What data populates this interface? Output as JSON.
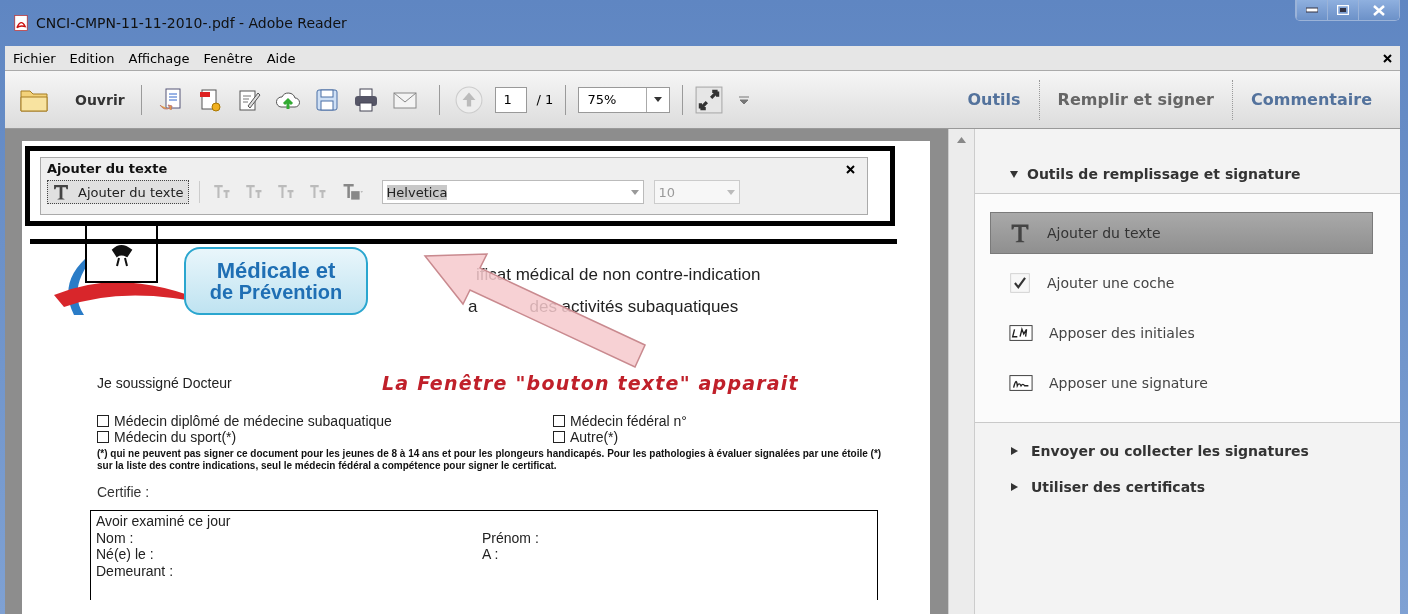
{
  "window": {
    "title": "CNCI-CMPN-11-11-2010-.pdf - Adobe Reader"
  },
  "menu": [
    "Fichier",
    "Edition",
    "Affichage",
    "Fenêtre",
    "Aide"
  ],
  "toolbar": {
    "open_label": "Ouvrir",
    "page": "1",
    "page_total": "/ 1",
    "zoom": "75%",
    "tabs": [
      {
        "label": "Outils",
        "selected": false
      },
      {
        "label": "Remplir et signer",
        "selected": true
      },
      {
        "label": "Commentaire",
        "selected": false
      }
    ]
  },
  "text_toolbar": {
    "title": "Ajouter du texte",
    "button": "Ajouter du texte",
    "font": "Helvetica",
    "size": "10"
  },
  "document": {
    "logo_lines": [
      "Médicale et",
      "de Prévention"
    ],
    "heading_lines": [
      "ificat médical de non contre-indication",
      "des activités subaquatiques"
    ],
    "heading_fragment": "a",
    "signed": "Je soussigné Docteur",
    "options": [
      {
        "label": "Médecin diplômé de médecine subaquatique",
        "checked": false
      },
      {
        "label": "Médecin fédéral n°",
        "checked": false
      },
      {
        "label": "Médecin du sport(*)",
        "checked": false
      },
      {
        "label": "Autre(*)",
        "checked": false
      }
    ],
    "footnote": "(*) qui ne peuvent pas signer ce document pour les jeunes de 8 à 14 ans et pour les plongeurs handicapés. Pour les pathologies à évaluer  signalées par une étoile (*) sur la liste des contre indications, seul le médecin fédéral a compétence pour signer le certificat.",
    "certifie": "Certifie :",
    "exam_intro": "Avoir examiné ce jour",
    "exam_rows": [
      [
        "Nom :",
        "Prénom :"
      ],
      [
        "Né(e) le :",
        "A :"
      ],
      [
        "Demeurant :"
      ]
    ]
  },
  "annotation": "La Fenêtre \"bouton texte\" apparait",
  "panel": {
    "header": {
      "title": "Outils de remplissage et signature",
      "expanded": true
    },
    "items": [
      {
        "label": "Ajouter du texte",
        "kind": "text",
        "selected": true
      },
      {
        "label": "Ajouter une coche",
        "kind": "check",
        "selected": false
      },
      {
        "label": "Apposer des initiales",
        "kind": "initials",
        "selected": false
      },
      {
        "label": "Apposer une signature",
        "kind": "signature",
        "selected": false
      }
    ],
    "sections": [
      {
        "title": "Envoyer ou collecter les signatures",
        "expanded": false
      },
      {
        "title": "Utiliser des certificats",
        "expanded": false
      }
    ]
  }
}
